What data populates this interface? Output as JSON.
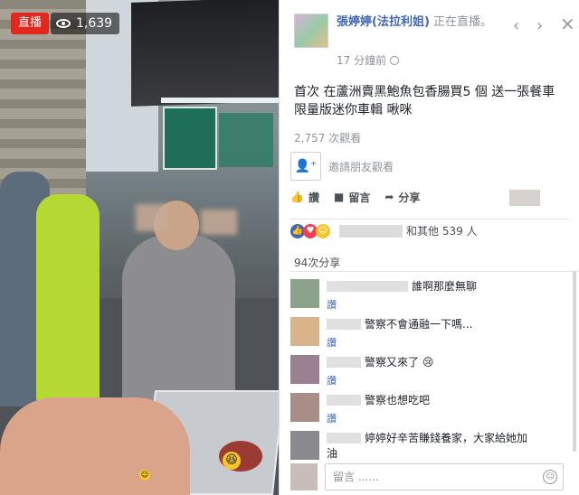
{
  "video": {
    "live_badge": "直播",
    "viewer_count": "1,639"
  },
  "post": {
    "page_name": "張婷婷(法拉利姐)",
    "status_text": "正在直播。",
    "time": "17 分鐘前",
    "text": "首次 在蘆洲賣黑鮑魚包香腸買5 個 送一張餐車限量版迷你車輯 啾咪",
    "views": "2,757 次觀看",
    "tag_friends": "邀請朋友觀看"
  },
  "actions": {
    "like": "讚",
    "comment": "留言",
    "share": "分享"
  },
  "reactions": {
    "others_text": "和其他 539 人"
  },
  "shares": {
    "count": "94次分享"
  },
  "comments": [
    {
      "text": "誰啊那麼無聊",
      "like": "讚"
    },
    {
      "text": "警察不會通融一下嗎...",
      "like": "讚"
    },
    {
      "text": "警察又來了 😢",
      "like": "讚"
    },
    {
      "text": "警察也想吃吧",
      "like": "讚"
    },
    {
      "text": "婷婷好辛苦賺錢養家，大家給她加",
      "text2": "油"
    }
  ],
  "comment_box": {
    "placeholder": "留言 ......"
  },
  "colors": {
    "brand_blue": "#4267b2",
    "live_red": "#e0281e"
  }
}
